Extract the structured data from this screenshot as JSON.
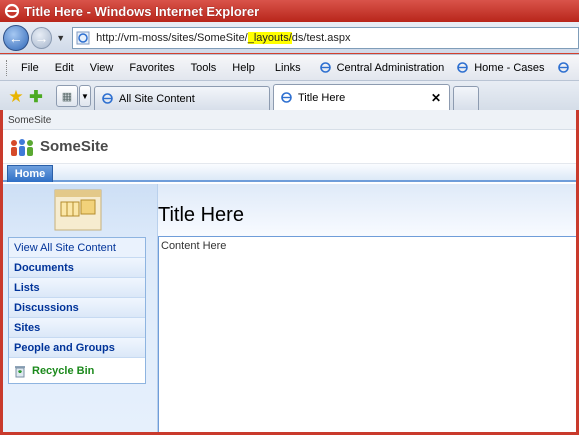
{
  "window": {
    "title": "Title Here - Windows Internet Explorer"
  },
  "address": {
    "url_prefix": "http://vm-moss/sites/SomeSite/",
    "url_highlight": "_layouts/",
    "url_suffix": "ds/test.aspx"
  },
  "menu": {
    "items": [
      {
        "label": "File"
      },
      {
        "label": "Edit"
      },
      {
        "label": "View"
      },
      {
        "label": "Favorites"
      },
      {
        "label": "Tools"
      },
      {
        "label": "Help"
      }
    ],
    "links_label": "Links",
    "favorites": [
      {
        "label": "Central Administration"
      },
      {
        "label": "Home - Cases"
      }
    ]
  },
  "tabs": [
    {
      "label": "All Site Content",
      "active": false
    },
    {
      "label": "Title Here",
      "active": true
    }
  ],
  "site": {
    "breadcrumb": "SomeSite",
    "name": "SomeSite",
    "home_tab": "Home",
    "page_title": "Title Here",
    "content": "Content Here"
  },
  "quicklaunch": {
    "view_all": "View All Site Content",
    "items": [
      {
        "label": "Documents"
      },
      {
        "label": "Lists"
      },
      {
        "label": "Discussions"
      },
      {
        "label": "Sites"
      },
      {
        "label": "People and Groups"
      }
    ],
    "recycle_bin": "Recycle Bin"
  },
  "colors": {
    "title_bar": "#c93a2c",
    "address_highlight": "#ffff00",
    "sharepoint_blue": "#003399",
    "recycle_green": "#1c8a1c"
  }
}
